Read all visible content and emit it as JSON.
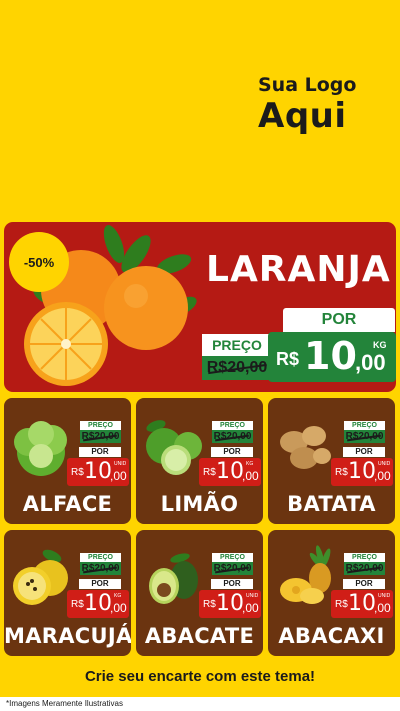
{
  "logo": {
    "line1": "Sua Logo",
    "line2": "Aqui"
  },
  "colors": {
    "background": "#FFD400",
    "hero": "#B51A14",
    "card": "#6B3410",
    "green": "#23843A",
    "red_price": "#D01E17"
  },
  "hero": {
    "discount": "-50%",
    "title": "LARANJA",
    "old_label": "PREÇO",
    "old_price": "R$20,00",
    "por_label": "POR",
    "currency": "R$",
    "price_int": "10",
    "price_dec": ",00",
    "unit": "KG",
    "image": "orange-icon"
  },
  "products": [
    {
      "name": "ALFACE",
      "old_label": "PREÇO",
      "old_price": "R$20,00",
      "por_label": "POR",
      "currency": "R$",
      "price_int": "10",
      "price_dec": ",00",
      "unit": "UNID",
      "image": "lettuce-icon"
    },
    {
      "name": "LIMÃO",
      "old_label": "PREÇO",
      "old_price": "R$20,00",
      "por_label": "POR",
      "currency": "R$",
      "price_int": "10",
      "price_dec": ",00",
      "unit": "KG",
      "image": "lime-icon"
    },
    {
      "name": "BATATA",
      "old_label": "PREÇO",
      "old_price": "R$20,00",
      "por_label": "POR",
      "currency": "R$",
      "price_int": "10",
      "price_dec": ",00",
      "unit": "UNID",
      "image": "potato-icon"
    },
    {
      "name": "MARACUJÁ",
      "old_label": "PREÇO",
      "old_price": "R$20,00",
      "por_label": "POR",
      "currency": "R$",
      "price_int": "10",
      "price_dec": ",00",
      "unit": "KG",
      "image": "passion-fruit-icon"
    },
    {
      "name": "ABACATE",
      "old_label": "PREÇO",
      "old_price": "R$20,00",
      "por_label": "POR",
      "currency": "R$",
      "price_int": "10",
      "price_dec": ",00",
      "unit": "UNID",
      "image": "avocado-icon"
    },
    {
      "name": "ABACAXI",
      "old_label": "PREÇO",
      "old_price": "R$20,00",
      "por_label": "POR",
      "currency": "R$",
      "price_int": "10",
      "price_dec": ",00",
      "unit": "UNID",
      "image": "pineapple-icon"
    }
  ],
  "tagline": "Crie seu encarte com este tema!",
  "disclaimer": "*Imagens Meramente Ilustrativas"
}
